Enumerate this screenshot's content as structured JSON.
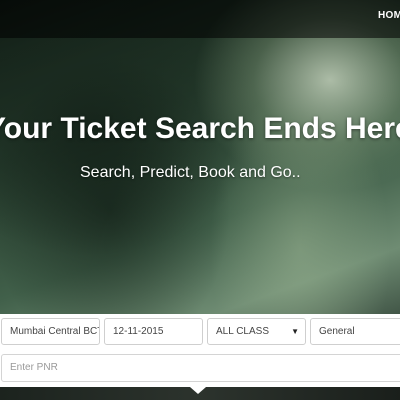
{
  "nav": {
    "home_label": "HOME"
  },
  "hero": {
    "headline": "Your Ticket Search Ends Here",
    "subline": "Search, Predict, Book and Go.."
  },
  "search": {
    "station_value": "Mumbai Central BCT",
    "date_value": "12-11-2015",
    "class_value": "ALL CLASS",
    "class_caret": "▼",
    "quota_value": "General"
  },
  "pnr": {
    "placeholder": "Enter PNR"
  }
}
